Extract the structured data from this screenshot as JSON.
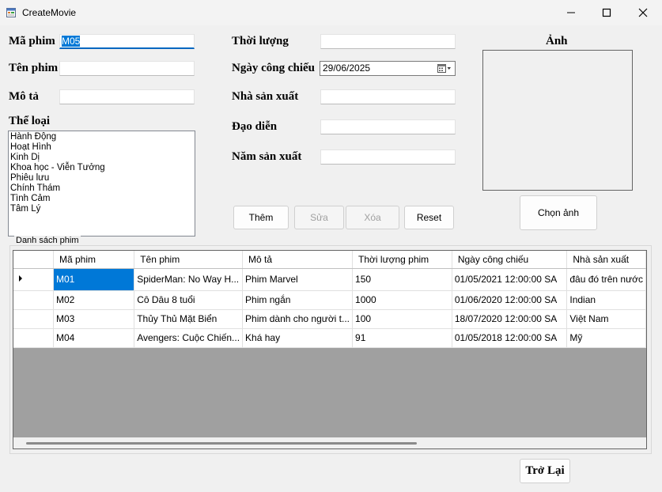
{
  "window": {
    "title": "CreateMovie",
    "controls": [
      "minimize-icon",
      "maximize-icon",
      "close-icon"
    ]
  },
  "form": {
    "ma_phim": {
      "label": "Mã phim",
      "value": "M05"
    },
    "ten_phim": {
      "label": "Tên phim",
      "value": ""
    },
    "mo_ta": {
      "label": "Mô tả",
      "value": ""
    },
    "the_loai": {
      "label": "Thể loại",
      "options": [
        "Hành Động",
        "Hoạt Hình",
        "Kinh Dị",
        "Khoa học - Viễn Tưởng",
        "Phiêu lưu",
        "Chính Thám",
        "Tình Cảm",
        "Tâm Lý"
      ]
    },
    "thoi_luong": {
      "label": "Thời lượng",
      "value": ""
    },
    "ngay_cong_chieu": {
      "label": "Ngày công chiếu",
      "value": "29/06/2025"
    },
    "nha_san_xuat": {
      "label": "Nhà sản xuất",
      "value": ""
    },
    "dao_dien": {
      "label": "Đạo diễn",
      "value": ""
    },
    "nam_san_xuat": {
      "label": "Năm sản xuất",
      "value": ""
    },
    "anh": {
      "label": "Ảnh"
    }
  },
  "buttons": {
    "them": "Thêm",
    "sua": "Sửa",
    "xoa": "Xóa",
    "reset": "Reset",
    "chon_anh": "Chọn ảnh",
    "tro_lai": "Trở Lại"
  },
  "grid": {
    "group_title": "Danh sách phim",
    "columns": [
      "Mã phim",
      "Tên phim",
      "Mô tả",
      "Thời lượng phim",
      "Ngày công chiếu",
      "Nhà sản xuất"
    ],
    "rows": [
      [
        "M01",
        "SpiderMan: No Way H...",
        "Phim Marvel",
        "150",
        "01/05/2021 12:00:00 SA",
        "đâu đó trên nước"
      ],
      [
        "M02",
        "Cô Dâu 8 tuổi",
        "Phim ngắn",
        "1000",
        "01/06/2020 12:00:00 SA",
        "Indian"
      ],
      [
        "M03",
        "Thủy Thủ Mặt Biển",
        "Phim dành cho người t...",
        "100",
        "18/07/2020 12:00:00 SA",
        "Việt Nam"
      ],
      [
        "M04",
        "Avengers: Cuộc Chiến...",
        "Khá hay",
        "91",
        "01/05/2018 12:00:00 SA",
        "Mỹ"
      ]
    ],
    "selected_cell": {
      "row": 0,
      "col": 0
    }
  },
  "colors": {
    "accent": "#0078d7",
    "grid_empty": "#a0a0a0",
    "background": "#f0f0f0"
  }
}
